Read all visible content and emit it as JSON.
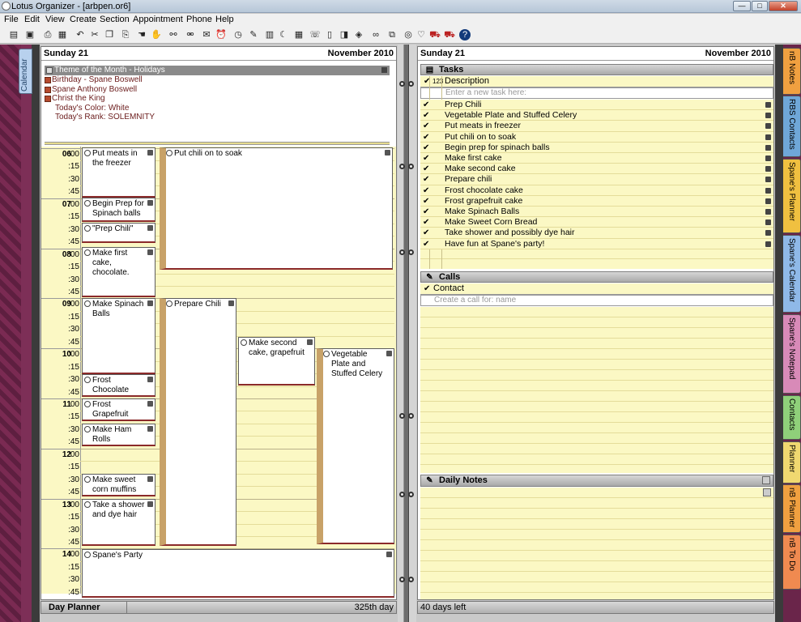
{
  "window": {
    "title": "Lotus Organizer - [arbpen.or6]",
    "min": "—",
    "max": "□",
    "close": "✕"
  },
  "menu": [
    "File",
    "Edit",
    "View",
    "Create",
    "Section",
    "Appointment",
    "Phone",
    "Help"
  ],
  "toolbar_icons": [
    "open-icon",
    "save-icon",
    "print-icon",
    "print-preview-icon",
    "undo-icon",
    "cut-icon",
    "copy-icon",
    "paste-icon",
    "hand-icon",
    "grab-icon",
    "link-icon",
    "unlink-icon",
    "mail-icon",
    "alarm-icon",
    "notes-icon",
    "pencil-icon",
    "book-icon",
    "page-icon",
    "calendar-icon",
    "phone-icon",
    "glasses-icon",
    "layout-icon",
    "dial-icon",
    "filter-icon",
    "sync-icon",
    "car-icon",
    "help-icon"
  ],
  "left_tab": "Calendar",
  "left_page": {
    "day": "Sunday 21",
    "month": "November 2010",
    "holiday_header": "Theme of the Month - Holidays",
    "holidays": [
      "Birthday - Spane Boswell",
      "Spane Anthony Boswell",
      "Christ the King"
    ],
    "notes": [
      "Today's Color: White",
      "Today's Rank: SOLEMNITY"
    ],
    "times": [
      {
        "h": "06",
        "m": ":00"
      },
      {
        "q": ":15"
      },
      {
        "q": ":30"
      },
      {
        "q": ":45"
      },
      {
        "h": "07",
        "m": ":00"
      },
      {
        "q": ":15"
      },
      {
        "q": ":30"
      },
      {
        "q": ":45"
      },
      {
        "h": "08",
        "m": ":00"
      },
      {
        "q": ":15"
      },
      {
        "q": ":30"
      },
      {
        "q": ":45"
      },
      {
        "h": "09",
        "m": ":00"
      },
      {
        "q": ":15"
      },
      {
        "q": ":30"
      },
      {
        "q": ":45"
      },
      {
        "h": "10",
        "m": ":00"
      },
      {
        "q": ":15"
      },
      {
        "q": ":30"
      },
      {
        "q": ":45"
      },
      {
        "h": "11",
        "m": ":00"
      },
      {
        "q": ":15"
      },
      {
        "q": ":30"
      },
      {
        "q": ":45"
      },
      {
        "h": "12",
        "m": ":00"
      },
      {
        "q": ":15"
      },
      {
        "q": ":30"
      },
      {
        "q": ":45"
      },
      {
        "h": "13",
        "m": ":00"
      },
      {
        "q": ":15"
      },
      {
        "q": ":30"
      },
      {
        "q": ":45"
      },
      {
        "h": "14",
        "m": ":00"
      },
      {
        "q": ":15"
      },
      {
        "q": ":30"
      },
      {
        "q": ":45"
      }
    ],
    "appointments": [
      "Put meats in the freezer",
      "Begin Prep for Spinach balls",
      "\"Prep Chili\"",
      "Make first cake, chocolate.",
      "Make Spinach Balls",
      "Frost Chocolate Cake",
      "Frost Grapefruit Cake",
      "Make Ham Rolls",
      "Make sweet corn muffins",
      "Take a shower and dye hair",
      "Spane's Party",
      "Put chili on to soak",
      "Prepare Chili",
      "Make second cake, grapefruit",
      "Vegetable Plate and Stuffed Celery"
    ],
    "footer_left": "Day Planner",
    "footer_right": "325th day"
  },
  "right_page": {
    "day": "Sunday 21",
    "month": "November 2010",
    "tasks_title": "Tasks",
    "tasks_col_num": "123",
    "tasks_col_desc": "Description",
    "tasks_new": "Enter a new task here:",
    "tasks": [
      "Prep Chili",
      "Vegetable Plate and Stuffed Celery",
      "Put meats in freezer",
      "Put chili on to soak",
      "Begin prep for spinach balls",
      "Make first cake",
      "Make second cake",
      "Prepare chili",
      "Frost chocolate cake",
      "Frost grapefruit cake",
      "Make Spinach Balls",
      "Make Sweet Corn Bread",
      "Take shower and possibly dye hair",
      "Have fun at Spane's party!"
    ],
    "check": "✔",
    "calls_title": "Calls",
    "calls_col": "Contact",
    "calls_new": "Create a call for: name",
    "notes_title": "Daily Notes",
    "footer_left": "40 days left"
  },
  "right_tabs": [
    "nB Notes",
    "RBS Contacts",
    "Spane's Planner",
    "Spane's Calendar",
    "Spane's Notepad",
    "Contacts",
    "Planner",
    "nB Planner",
    "nB To Do"
  ]
}
